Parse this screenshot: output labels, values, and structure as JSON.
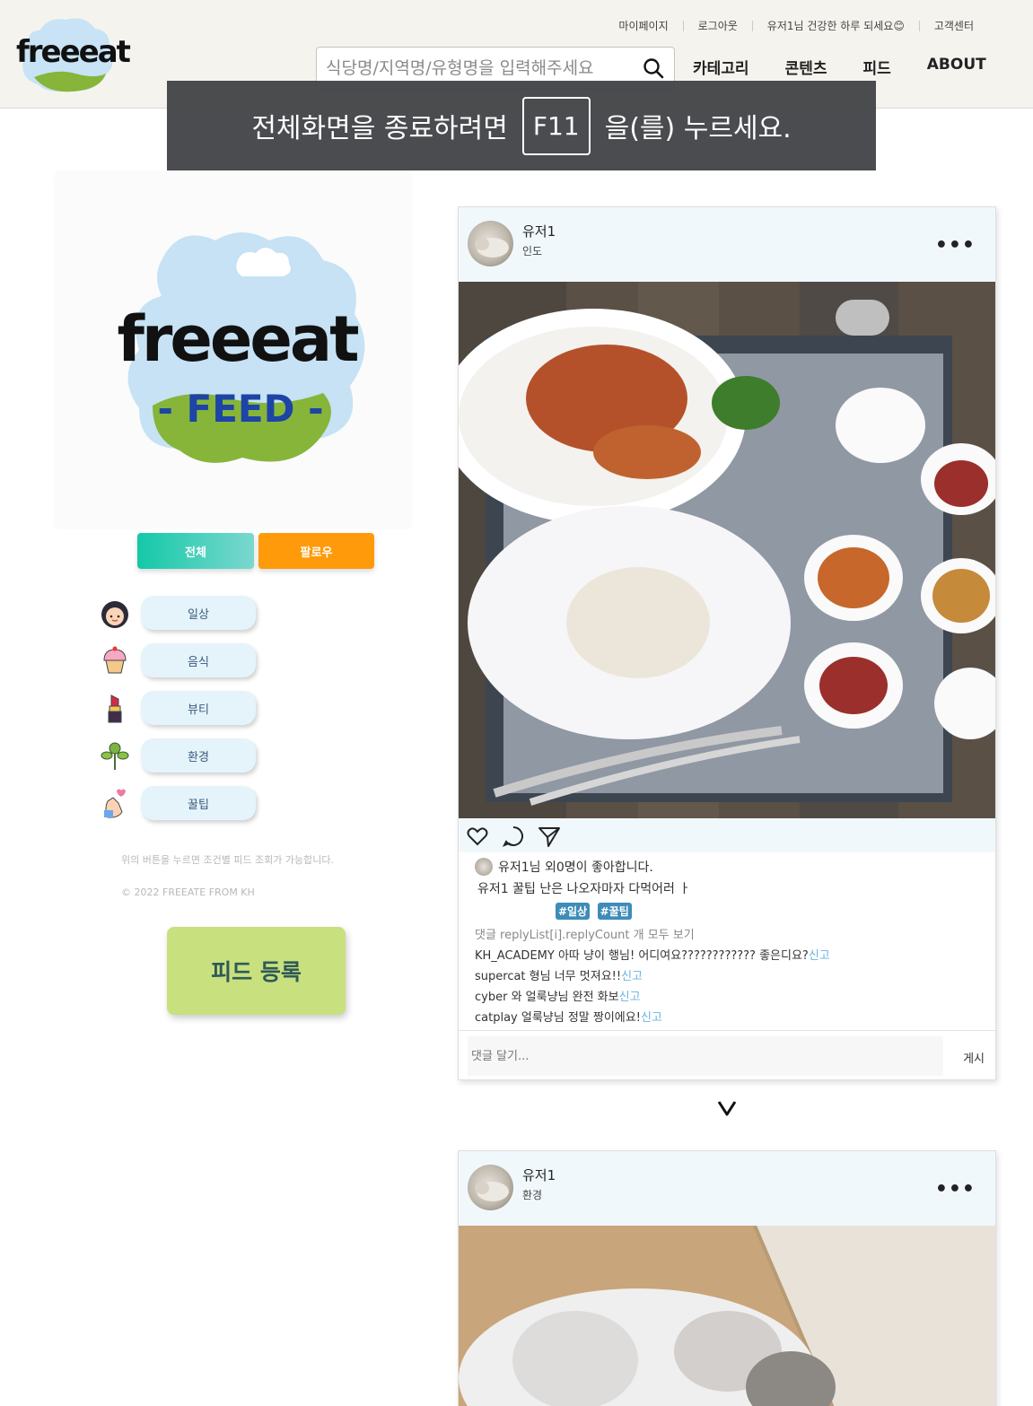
{
  "header": {
    "logo_text": "freeeat",
    "util_nav": [
      "마이페이지",
      "로그아웃",
      "유저1님 건강한 하루 되세요😊",
      "고객센터"
    ],
    "search_placeholder": "식당명/지역명/유형명을 입력해주세요",
    "main_nav": [
      "카테고리",
      "콘텐츠",
      "피드",
      "ABOUT"
    ]
  },
  "fullscreen_notice": {
    "before": "전체화면을 종료하려면",
    "key": "F11",
    "after": "을(를) 누르세요."
  },
  "feed_logo": {
    "title": "freeeat",
    "subtitle": "- FEED -"
  },
  "filter": {
    "all": "전체",
    "follow": "팔로우"
  },
  "categories": [
    {
      "label": "일상",
      "icon": "girl-face-icon"
    },
    {
      "label": "음식",
      "icon": "cupcake-icon"
    },
    {
      "label": "뷰티",
      "icon": "lipstick-icon"
    },
    {
      "label": "환경",
      "icon": "plant-icon"
    },
    {
      "label": "꿀팁",
      "icon": "finger-heart-icon"
    }
  ],
  "left_notes": {
    "hint": "위의 버튼을 누르면 조건별 피드 조회가 가능합니다.",
    "copyright": "© 2022 FREEATE FROM KH"
  },
  "register_button": "피드 등록",
  "posts": [
    {
      "user": "유저1",
      "location": "인도",
      "more": "•••",
      "likes": "유저1님 외0명이 좋아합니다.",
      "caption": "유저1 꿀팁 난은 나오자마자 다먹어러 ㅏ",
      "tags": [
        "#일상",
        "#꿀팁"
      ],
      "all_comments": "댓글 replyList[i].replyCount 개 모두 보기",
      "comments": [
        {
          "text": "KH_ACADEMY 아따 냥이 행님! 어디여요???????????? 좋은디요?",
          "report": "신고"
        },
        {
          "text": "supercat 형님 너무 멋져요!!",
          "report": "신고"
        },
        {
          "text": "cyber 와 얼룩냥님 완전 화보",
          "report": "신고"
        },
        {
          "text": "catplay 얼룩냥님 정말 짱이에요!",
          "report": "신고"
        }
      ],
      "comment_placeholder": "댓글 달기...",
      "post_button": "게시"
    },
    {
      "user": "유저1",
      "location": "환경",
      "more": "•••"
    }
  ]
}
